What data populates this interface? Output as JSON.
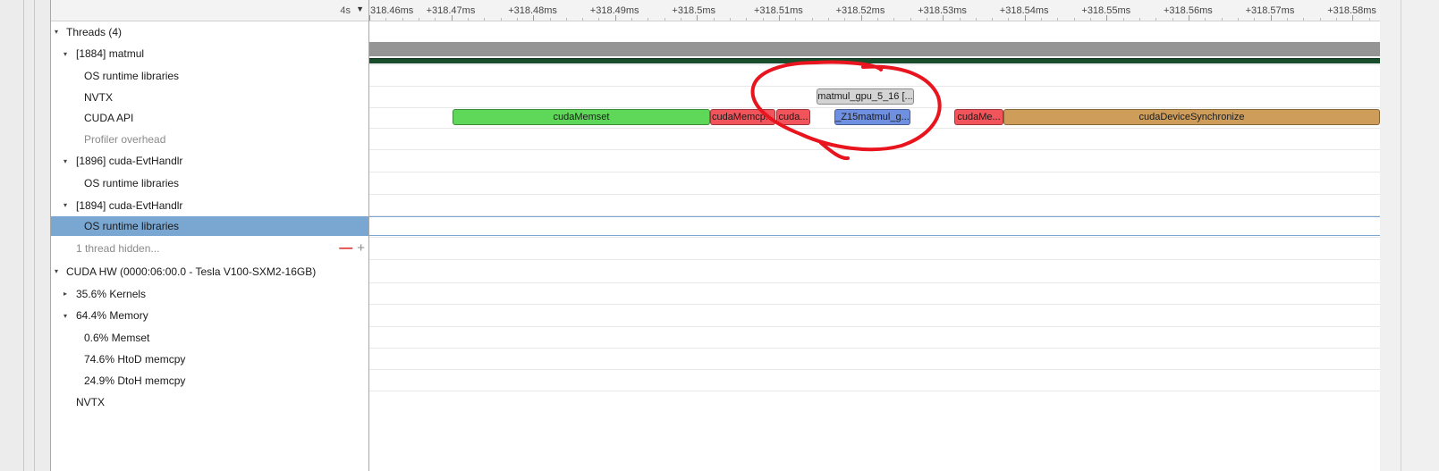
{
  "zoom_label": "4s",
  "tree": [
    {
      "label": "Threads (4)",
      "indent": 0,
      "expander": "open"
    },
    {
      "label": "[1884] matmul",
      "indent": 1,
      "expander": "open"
    },
    {
      "label": "OS runtime libraries",
      "indent": 2,
      "expander": "none"
    },
    {
      "label": "NVTX",
      "indent": 2,
      "expander": "none"
    },
    {
      "label": "CUDA API",
      "indent": 2,
      "expander": "none"
    },
    {
      "label": "Profiler overhead",
      "indent": 2,
      "expander": "none",
      "muted": true
    },
    {
      "label": "[1896] cuda-EvtHandlr",
      "indent": 1,
      "expander": "open"
    },
    {
      "label": "OS runtime libraries",
      "indent": 2,
      "expander": "none"
    },
    {
      "label": "[1894] cuda-EvtHandlr",
      "indent": 1,
      "expander": "open"
    },
    {
      "label": "OS runtime libraries",
      "indent": 2,
      "expander": "none",
      "selected": true
    },
    {
      "label": "1 thread hidden...",
      "indent": 1,
      "expander": "none",
      "muted": true,
      "controls": true
    },
    {
      "label": "CUDA HW (0000:06:00.0 - Tesla V100-SXM2-16GB)",
      "indent": 0,
      "expander": "open"
    },
    {
      "label": "35.6% Kernels",
      "indent": 1,
      "expander": "closed"
    },
    {
      "label": "64.4% Memory",
      "indent": 1,
      "expander": "open"
    },
    {
      "label": "0.6% Memset",
      "indent": 2,
      "expander": "none"
    },
    {
      "label": "74.6% HtoD memcpy",
      "indent": 2,
      "expander": "none"
    },
    {
      "label": "24.9% DtoH memcpy",
      "indent": 2,
      "expander": "none"
    },
    {
      "label": "NVTX",
      "indent": 1,
      "expander": "none"
    }
  ],
  "ruler_ticks": [
    "318.46ms",
    "+318.47ms",
    "+318.48ms",
    "+318.49ms",
    "+318.5ms",
    "+318.51ms",
    "+318.52ms",
    "+318.53ms",
    "+318.54ms",
    "+318.55ms",
    "+318.56ms",
    "+318.57ms",
    "+318.58ms"
  ],
  "nvtx_ranges": [
    {
      "label": "matmul_gpu_5_16 [...",
      "color": "#d4d4d4"
    }
  ],
  "cuda_api_calls": [
    {
      "label": "cudaMemset",
      "color": "#5fd85a"
    },
    {
      "label": "cudaMemcp...",
      "color": "#f2545b"
    },
    {
      "label": "cuda...",
      "color": "#f2545b"
    },
    {
      "label": "_Z15matmul_g...",
      "color": "#6f8fe0"
    },
    {
      "label": "cudaMe...",
      "color": "#f2545b"
    },
    {
      "label": "cudaDeviceSynchronize",
      "color": "#cf9d5a"
    }
  ],
  "annotation_color": "#e8141e"
}
